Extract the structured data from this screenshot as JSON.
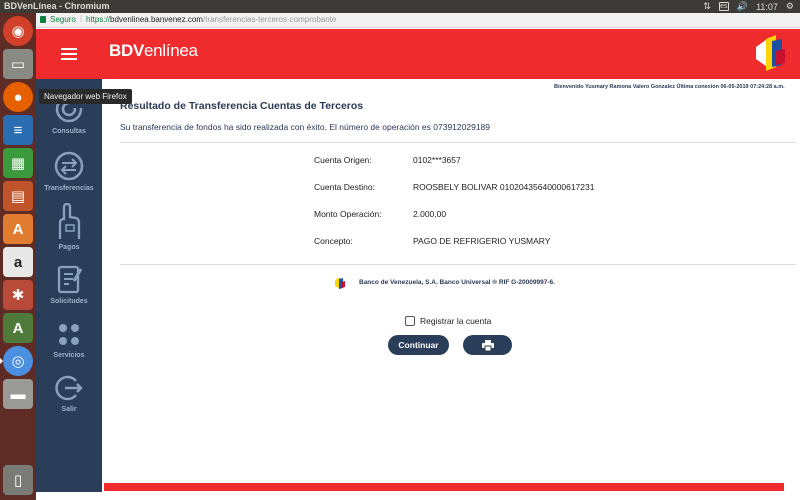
{
  "window": {
    "title": "BDVenLínea - Chromium",
    "clock": "11:07",
    "keyboard": "es"
  },
  "launcher": {
    "tooltip": "Navegador web Firefox",
    "items": [
      "ubuntu-icon",
      "files-icon",
      "firefox-icon",
      "writer-icon",
      "calc-icon",
      "impress-icon",
      "software-center-icon",
      "amazon-icon",
      "settings-icon",
      "update-icon",
      "chromium-icon",
      "drive-icon",
      "trash-icon"
    ]
  },
  "address_bar": {
    "secure_label": "Seguro",
    "url_proto": "https://",
    "url_host": "bdvenlinea.banvenez.com",
    "url_path": "/transferencias-terceros-comprobante"
  },
  "header": {
    "logo_bold": "BDV",
    "logo_rest": "enlínea"
  },
  "sidebar": {
    "items": [
      {
        "label": "Consultas",
        "icon": "consultas-icon"
      },
      {
        "label": "Transferencias",
        "icon": "transfer-icon"
      },
      {
        "label": "Pagos",
        "icon": "payments-icon"
      },
      {
        "label": "Solicitudes",
        "icon": "requests-icon"
      },
      {
        "label": "Servicios",
        "icon": "services-icon"
      },
      {
        "label": "Salir",
        "icon": "logout-icon"
      }
    ]
  },
  "welcome": "Bienvenido Yusmary Ramona  Valero Gonzalez  Última conexión 06-05-2019 07:24:28 a.m.",
  "result": {
    "title": "Resultado de Transferencia Cuentas de Terceros",
    "message": "Su transferencia de fondos ha sido realizada con éxito. El número de operación es 073912029189"
  },
  "details": [
    {
      "label": "Cuenta Origen:",
      "value": "0102***3657"
    },
    {
      "label": "Cuenta Destino:",
      "value": "ROOSBELY BOLIVAR 01020435640000617231"
    },
    {
      "label": "Monto Operación:",
      "value": "2.000,00"
    },
    {
      "label": "Concepto:",
      "value": "PAGO DE REFRIGERIO YUSMARY"
    }
  ],
  "footer": "Banco de Venezuela, S.A. Banco Universal ® RIF G-20009997-6.",
  "actions": {
    "register_label": "Registrar la cuenta",
    "continue_label": "Continuar",
    "print_icon": "printer-icon"
  },
  "colors": {
    "brand_red": "#ef2b2d",
    "sidebar_navy": "#2b3e59",
    "launcher_bg": "#5e2c24"
  }
}
